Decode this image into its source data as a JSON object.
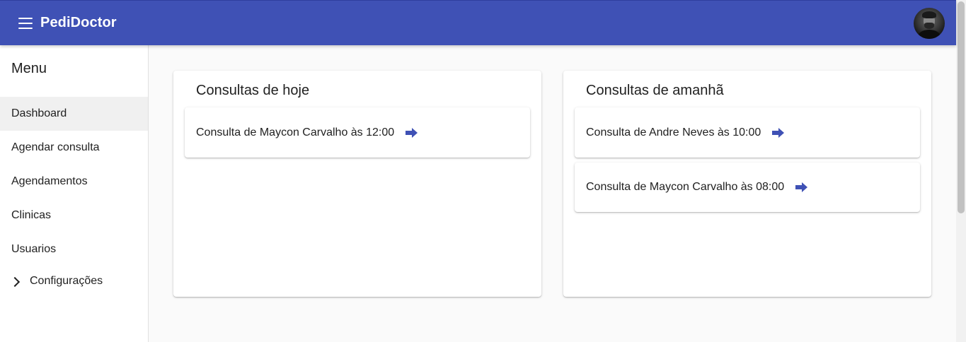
{
  "header": {
    "app_title": "PediDoctor",
    "menu_icon": "hamburger-menu-icon",
    "accent_color": "#3f51b5"
  },
  "sidebar": {
    "title": "Menu",
    "items": [
      {
        "label": "Dashboard",
        "active": true
      },
      {
        "label": "Agendar consulta"
      },
      {
        "label": "Agendamentos"
      },
      {
        "label": "Clinicas"
      },
      {
        "label": "Usuarios"
      },
      {
        "label": "Configurações",
        "icon": "chevron-right-icon"
      }
    ]
  },
  "today": {
    "title": "Consultas de hoje",
    "items": [
      {
        "text": "Consulta de Maycon Carvalho às 12:00",
        "icon": "arrow-right-icon"
      }
    ]
  },
  "tomorrow": {
    "title": "Consultas de amanhã",
    "items": [
      {
        "text": "Consulta de Andre Neves às 10:00",
        "icon": "arrow-right-icon"
      },
      {
        "text": "Consulta de Maycon Carvalho às 08:00",
        "icon": "arrow-right-icon"
      }
    ]
  }
}
